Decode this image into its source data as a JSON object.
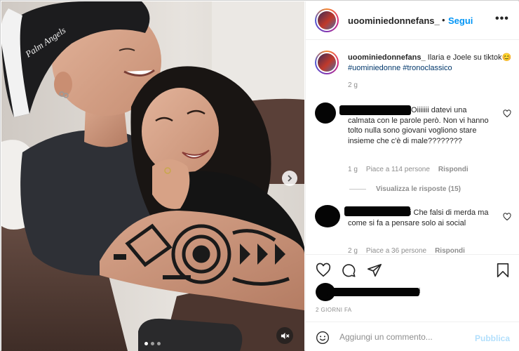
{
  "post": {
    "username": "uoominiedonnefans_",
    "follow_label": "Segui",
    "follow_dot": "•",
    "more_label": "•••"
  },
  "caption": {
    "username": "uoominiedonnefans_",
    "text": " Ilaria e Joele su tiktok",
    "emoji": "😊",
    "hashtags": [
      "#uominiedonne",
      "#tronoclassico"
    ],
    "time": "2 g"
  },
  "comments": [
    {
      "text": "Oiiiiiii datevi una calmata con le parole però. Non vi hanno tolto nulla sono giovani vogliono stare insieme che c'è di male????????",
      "time": "1 g",
      "likes": "Piace a 114 persone",
      "reply": "Rispondi",
      "view_replies": "Visualizza le risposte (15)"
    },
    {
      "text": "i Che falsi di merda ma come si fa a pensare solo ai social",
      "time": "2 g",
      "likes": "Piace a 36 persone",
      "reply": "Rispondi"
    }
  ],
  "likes_tail": "i",
  "time_ago": "2 GIORNI FA",
  "add_comment": {
    "placeholder": "Aggiungi un commento...",
    "publish_label": "Pubblica"
  },
  "media": {
    "cap_text": "Palm Angels",
    "dots_total": 3,
    "active_dot": 1
  },
  "colors": {
    "link_blue": "#0095f6",
    "hashtag": "#00376b",
    "muted": "#8e8e8e",
    "text": "#262626",
    "publish_disabled": "#b2dffc"
  }
}
